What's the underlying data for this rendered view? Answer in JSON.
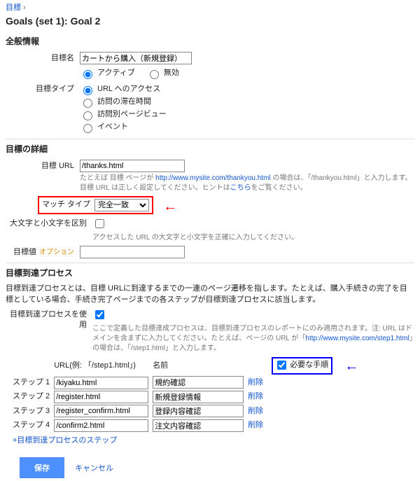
{
  "breadcrumb": "目標",
  "heading": "Goals (set 1): Goal 2",
  "sections": {
    "general": "全般情報",
    "detail": "目標の詳細",
    "funnel": "目標到達プロセス"
  },
  "labels": {
    "goal_name": "目標名",
    "goal_type": "目標タイプ",
    "goal_url": "目標 URL",
    "match_type": "マッチ タイプ",
    "case_sensitive": "大文字と小文字を区別",
    "goal_value": "目標値",
    "use_funnel": "目標到達プロセスを使用",
    "url_col": "URL(例: 「/step1.html」)",
    "name_col": "名前",
    "required": "必要な手順",
    "delete": "削除",
    "add_step": "+目標到達プロセスのステップ",
    "optional": "オプション"
  },
  "values": {
    "goal_name": "カートから購入（新規登録）",
    "goal_url": "/thanks.html"
  },
  "radios": {
    "active": "アクティブ",
    "inactive": "無効",
    "url_access": "URL へのアクセス",
    "time_on_site": "訪問の滞在時間",
    "pageviews": "訪問別ページビュー",
    "event": "イベント"
  },
  "match_options": {
    "exact": "完全一致"
  },
  "hints": {
    "url_pre": "たとえば 目標 ページが ",
    "url_link": "http://www.mysite.com/thankyou.html",
    "url_post": " の場合は、「/thankyou.html」と入力します。目標 URL は正しく設定してください。ヒントは",
    "url_kochira": "こちら",
    "url_end": "をご覧ください。",
    "case": "アクセスした URL の大文字と小文字を正確に入力してください。",
    "funnel_desc": "目標到達プロセスとは、目標 URLに到達するまでの一連のページ遷移を指します。たとえば、購入手続きの完了を目標としている場合、手続き完了ページまでの各ステップが目標到達プロセスに該当します。",
    "funnel_use_pre": "ここで定義した目標達成プロセスは、目標到達プロセスのレポートにのみ適用されます。注: URL はドメインを含まずに入力してください。たとえば、ページの URL が「",
    "funnel_use_link": "http://www.mysite.com/step1.html",
    "funnel_use_post": "」の場合は、「/step1.html」と入力します。"
  },
  "steps": [
    {
      "label": "ステップ 1",
      "url": "/kiyaku.html",
      "name": "規約確認"
    },
    {
      "label": "ステップ 2",
      "url": "/register.html",
      "name": "新規登録情報"
    },
    {
      "label": "ステップ 3",
      "url": "/register_confirm.html",
      "name": "登録内容確認"
    },
    {
      "label": "ステップ 4",
      "url": "/confirm2.html",
      "name": "注文内容確認"
    }
  ],
  "buttons": {
    "save": "保存",
    "cancel": "キャンセル"
  }
}
